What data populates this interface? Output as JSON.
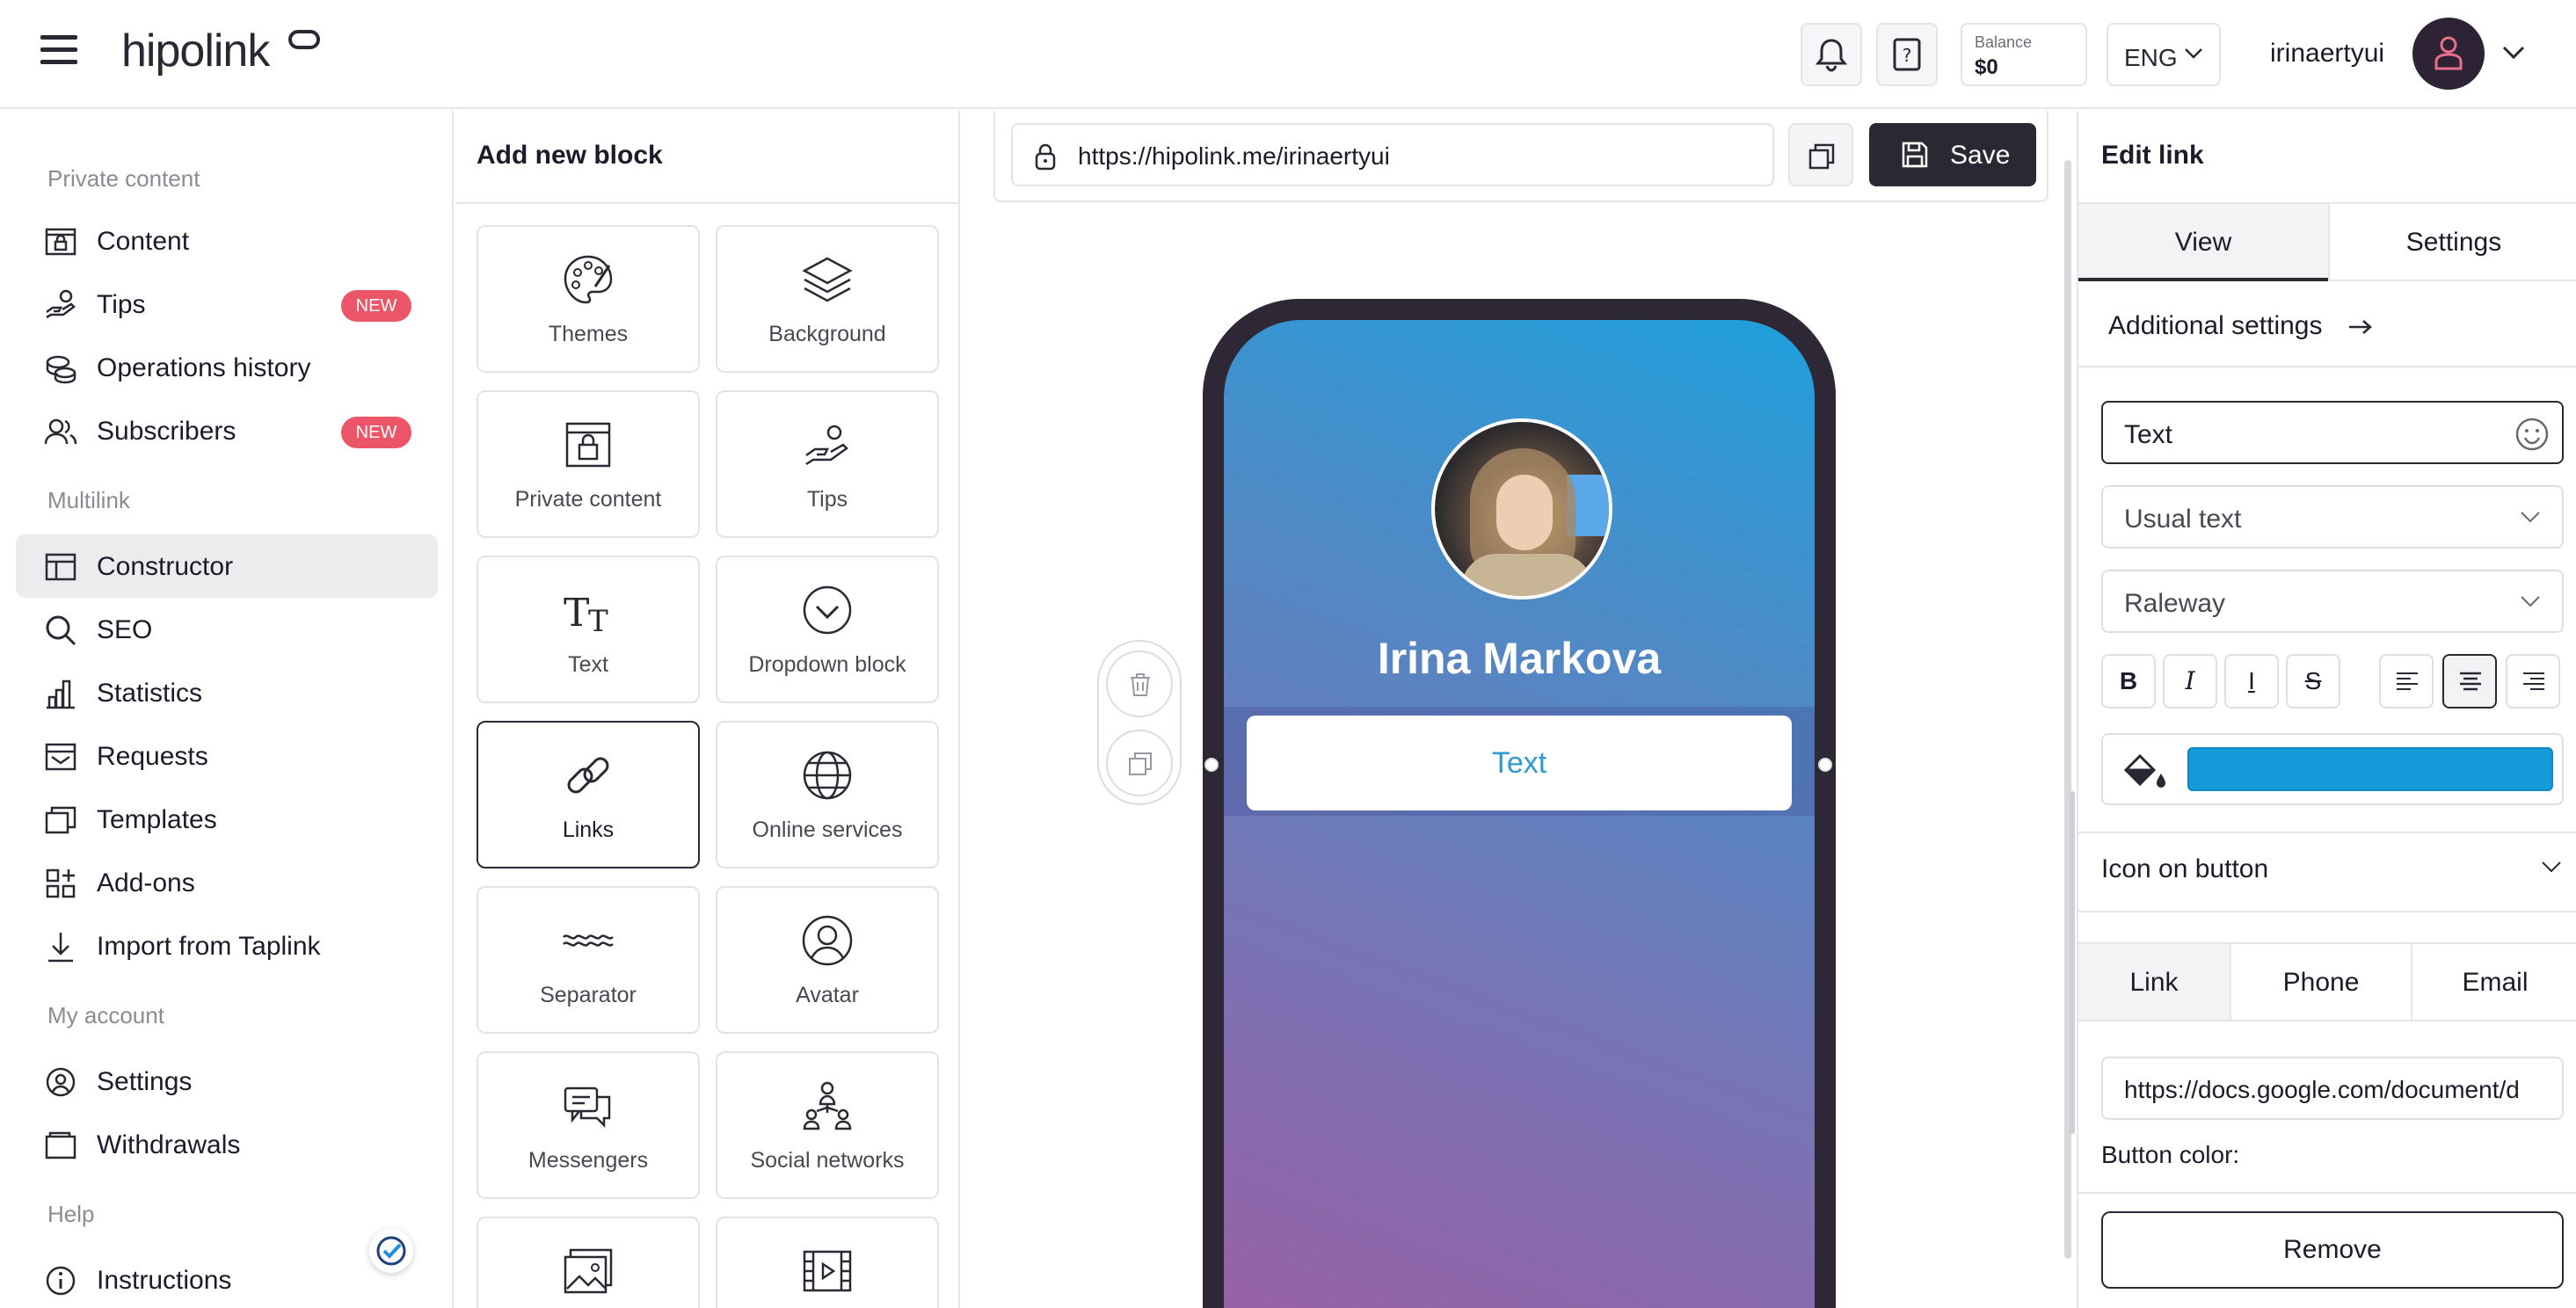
{
  "header": {
    "logo": "hipolink",
    "balance_label": "Balance",
    "balance_value": "$0",
    "language": "ENG",
    "username": "irinaertyui"
  },
  "sidebar": {
    "sections": {
      "private": "Private content",
      "multilink": "Multilink",
      "account": "My account",
      "help": "Help"
    },
    "items": [
      {
        "label": "Content",
        "icon": "lock-window-icon"
      },
      {
        "label": "Tips",
        "icon": "hand-coin-icon",
        "badge": "NEW"
      },
      {
        "label": "Operations history",
        "icon": "coins-icon"
      },
      {
        "label": "Subscribers",
        "icon": "users-icon",
        "badge": "NEW"
      },
      {
        "label": "Constructor",
        "icon": "layout-icon",
        "active": true
      },
      {
        "label": "SEO",
        "icon": "search-icon"
      },
      {
        "label": "Statistics",
        "icon": "bar-chart-icon"
      },
      {
        "label": "Requests",
        "icon": "inbox-icon"
      },
      {
        "label": "Templates",
        "icon": "copy-icon"
      },
      {
        "label": "Add-ons",
        "icon": "grid-plus-icon"
      },
      {
        "label": "Import from Taplink",
        "icon": "download-icon"
      },
      {
        "label": "Settings",
        "icon": "gear-user-icon"
      },
      {
        "label": "Withdrawals",
        "icon": "wallet-icon"
      },
      {
        "label": "Instructions",
        "icon": "info-icon"
      }
    ]
  },
  "blocks": {
    "title": "Add new block",
    "tiles": [
      {
        "label": "Themes",
        "icon": "palette-icon"
      },
      {
        "label": "Background",
        "icon": "layers-icon"
      },
      {
        "label": "Private content",
        "icon": "lock-window-icon"
      },
      {
        "label": "Tips",
        "icon": "hand-coin-icon"
      },
      {
        "label": "Text",
        "icon": "text-icon"
      },
      {
        "label": "Dropdown block",
        "icon": "chevron-circle-icon"
      },
      {
        "label": "Links",
        "icon": "link-icon",
        "selected": true
      },
      {
        "label": "Online services",
        "icon": "globe-icon"
      },
      {
        "label": "Separator",
        "icon": "wave-icon"
      },
      {
        "label": "Avatar",
        "icon": "avatar-icon"
      },
      {
        "label": "Messengers",
        "icon": "chat-icon"
      },
      {
        "label": "Social networks",
        "icon": "network-icon"
      },
      {
        "label": "",
        "icon": "image-icon"
      },
      {
        "label": "",
        "icon": "video-icon"
      }
    ]
  },
  "preview": {
    "url": "https://hipolink.me/irinaertyui",
    "save_label": "Save",
    "profile_name": "Irina Markova",
    "text_button": "Text"
  },
  "edit": {
    "title": "Edit link",
    "tabs": [
      "View",
      "Settings"
    ],
    "additional_settings": "Additional settings",
    "text_value": "Text",
    "text_style": "Usual text",
    "font": "Raleway",
    "format_buttons": [
      "B",
      "I",
      "I",
      "S"
    ],
    "color": "#1499d9",
    "icon_on_button": "Icon on button",
    "link_tabs": [
      "Link",
      "Phone",
      "Email"
    ],
    "link_value": "https://docs.google.com/document/d",
    "button_color_label": "Button color:",
    "remove_label": "Remove"
  }
}
